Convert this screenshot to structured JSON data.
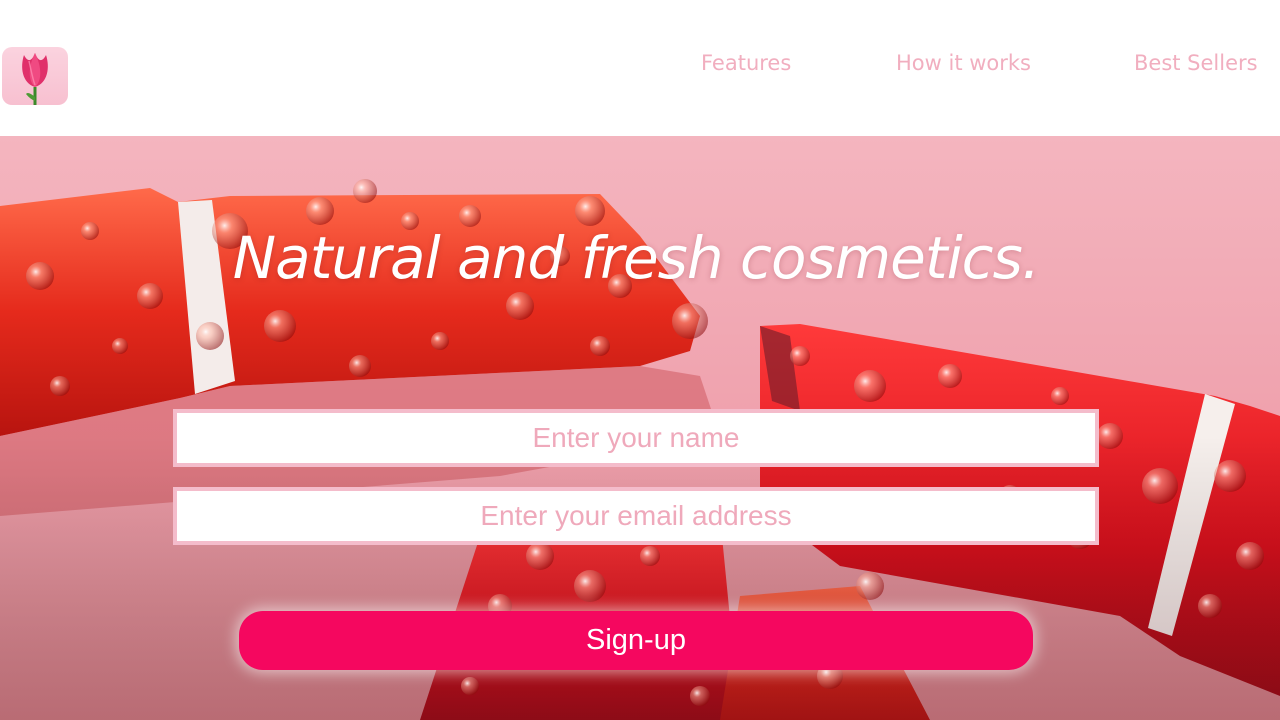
{
  "nav": {
    "items": [
      {
        "label": "Features"
      },
      {
        "label": "How it works"
      },
      {
        "label": "Best Sellers"
      }
    ]
  },
  "hero": {
    "headline": "Natural and fresh cosmetics.",
    "name_placeholder": "Enter your name",
    "email_placeholder": "Enter your email address",
    "signup_label": "Sign-up"
  },
  "colors": {
    "accent": "#f5075f",
    "nav_text": "#f1aebf",
    "field_border": "#f4bccb",
    "placeholder": "#efa9bb",
    "hero_background": "#f3a9b5",
    "lipstick_red": "#e8231c"
  },
  "icons": {
    "logo": "tulip-icon"
  }
}
